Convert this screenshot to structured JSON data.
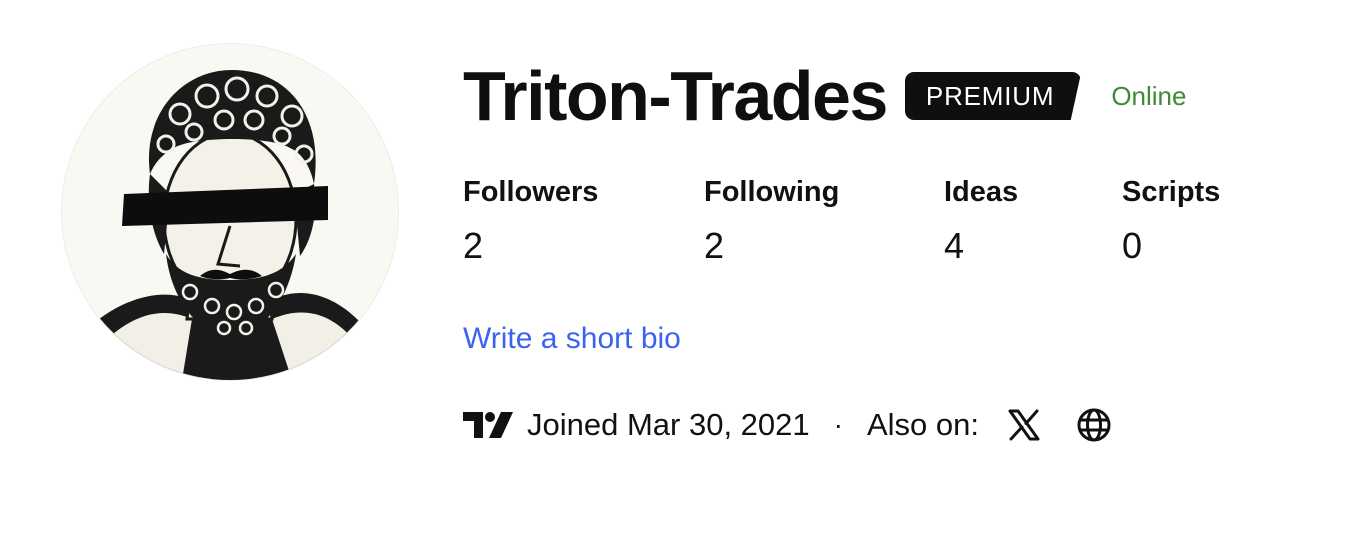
{
  "profile": {
    "username": "Triton-Trades",
    "badge": "PREMIUM",
    "status": "Online",
    "avatar_icon": "bust-avatar-icon"
  },
  "stats": {
    "followers": {
      "label": "Followers",
      "value": "2"
    },
    "following": {
      "label": "Following",
      "value": "2"
    },
    "ideas": {
      "label": "Ideas",
      "value": "4"
    },
    "scripts": {
      "label": "Scripts",
      "value": "0"
    }
  },
  "bio": {
    "link": "Write a short bio"
  },
  "meta": {
    "logo_icon": "tradingview-logo-icon",
    "joined": "Joined Mar 30, 2021",
    "separator": "·",
    "also_on": "Also on:",
    "social": [
      "x-icon",
      "globe-icon"
    ]
  },
  "colors": {
    "status_green": "#3d8a37",
    "link_blue": "#3c62f0",
    "badge_bg": "#0f0f0f"
  }
}
